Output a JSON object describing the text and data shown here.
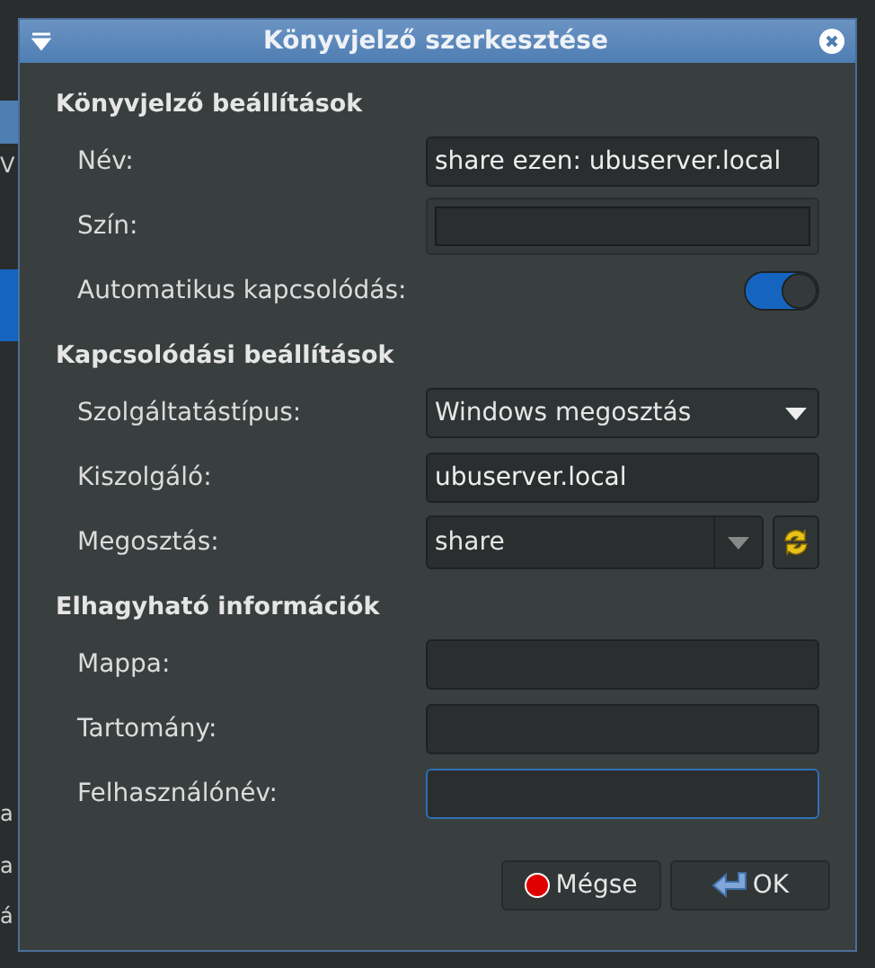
{
  "background": {
    "fragments": [
      "V",
      "a",
      "a",
      "á"
    ]
  },
  "window": {
    "title": "Könyvjelző szerkesztése"
  },
  "sections": [
    {
      "title": "Könyvjelző beállítások",
      "rows": [
        {
          "kind": "text",
          "label": "Név:",
          "value": "share ezen: ubuserver.local",
          "focused": false
        },
        {
          "kind": "color",
          "label": "Szín:"
        },
        {
          "kind": "switch",
          "label": "Automatikus kapcsolódás:",
          "on": true
        }
      ]
    },
    {
      "title": "Kapcsolódási beállítások",
      "rows": [
        {
          "kind": "dropdown",
          "label": "Szolgáltatástípus:",
          "value": "Windows megosztás"
        },
        {
          "kind": "text",
          "label": "Kiszolgáló:",
          "value": "ubuserver.local",
          "focused": false
        },
        {
          "kind": "combo",
          "label": "Megosztás:",
          "value": "share"
        }
      ]
    },
    {
      "title": "Elhagyható információk",
      "rows": [
        {
          "kind": "text",
          "label": "Mappa:",
          "value": "",
          "focused": false
        },
        {
          "kind": "text",
          "label": "Tartomány:",
          "value": "",
          "focused": false
        },
        {
          "kind": "text",
          "label": "Felhasználónév:",
          "value": "",
          "focused": true
        }
      ]
    }
  ],
  "buttons": [
    {
      "kind": "cancel",
      "label": "Mégse"
    },
    {
      "kind": "ok",
      "label": "OK"
    }
  ]
}
